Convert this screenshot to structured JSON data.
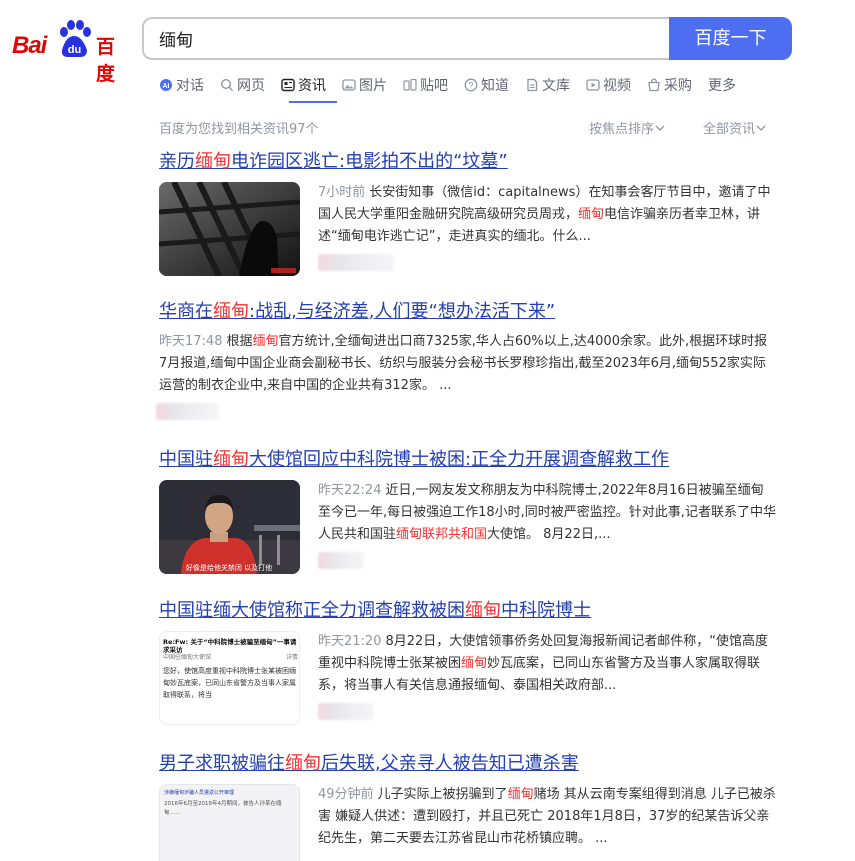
{
  "logo": {
    "bai": "Bai",
    "du": "du",
    "cn": "百度"
  },
  "search": {
    "query": "缅甸",
    "button_label": "百度一下"
  },
  "tabs": [
    {
      "label": "对话",
      "icon": "ai-chat-icon"
    },
    {
      "label": "网页",
      "icon": "search-icon"
    },
    {
      "label": "资讯",
      "icon": "news-icon"
    },
    {
      "label": "图片",
      "icon": "image-icon"
    },
    {
      "label": "贴吧",
      "icon": "tieba-icon"
    },
    {
      "label": "知道",
      "icon": "question-icon"
    },
    {
      "label": "文库",
      "icon": "document-icon"
    },
    {
      "label": "视频",
      "icon": "video-icon"
    },
    {
      "label": "采购",
      "icon": "shopping-icon"
    },
    {
      "label": "更多",
      "icon": ""
    }
  ],
  "info": {
    "count_text": "百度为您找到相关资讯97个",
    "sort_label": "按焦点排序",
    "filter_label": "全部资讯"
  },
  "results": [
    {
      "title_pre": "亲历",
      "title_hl": "缅甸",
      "title_post": "电诈园区逃亡:电影拍不出的“坟墓”",
      "time": "7小时前",
      "snippet_pre": "长安街知事（微信id：capitalnews）在知事会客厅节目中，邀请了中国人民大学重阳金融研究院高级研究员周戎，",
      "snippet_hl": "缅甸",
      "snippet_post": "电信诈骗亲历者幸卫林，讲述“缅甸电诈逃亡记”，走进真实的缅北。什么..."
    },
    {
      "title_pre": "华商在",
      "title_hl": "缅甸",
      "title_post": ":战乱,与经济差,人们要“想办法活下来”",
      "time": "昨天17:48",
      "snippet_pre": "根据",
      "snippet_hl": "缅甸",
      "snippet_post": "官方统计,全缅甸进出口商7325家,华人占60%以上,达4000余家。此外,根据环球时报7月报道,缅甸中国企业商会副秘书长、纺织与服装分会秘书长罗穆珍指出,截至2023年6月,缅甸552家实际运营的制衣企业中,来自中国的企业共有312家。 ..."
    },
    {
      "title_pre": "中国驻",
      "title_hl": "缅甸",
      "title_post": "大使馆回应中科院博士被困:正全力开展调查解救工作",
      "time": "昨天22:24",
      "snippet_pre": "近日,一网友发文称朋友为中科院博士,2022年8月16日被骗至缅甸至今已一年,每日被强迫工作18小时,同时被严密监控。针对此事,记者联系了中华人民共和国驻",
      "snippet_hl": "缅甸联邦共和国",
      "snippet_post": "大使馆。 8月22日,..."
    },
    {
      "title_pre": "中国驻缅大使馆称正全力调查解救被困",
      "title_hl": "缅甸",
      "title_post": "中科院博士",
      "time": "昨天21:20",
      "snippet_pre": "8月22日，大使馆领事侨务处回复海报新闻记者邮件称，“使馆高度重视中科院博士张某被困",
      "snippet_hl": "缅甸",
      "snippet_post": "妙瓦底案，已同山东省警方及当事人家属取得联系，将当事人有关信息通报缅甸、泰国相关政府部..."
    },
    {
      "title_pre": "男子求职被骗往",
      "title_hl": "缅甸",
      "title_post": "后失联,父亲寻人被告知已遭杀害",
      "time": "49分钟前",
      "snippet_pre": "儿子实际上被拐骗到了",
      "snippet_hl": "缅甸",
      "snippet_post": "赌场 其从云南专案组得到消息 儿子已被杀害 嫌疑人供述：遭到殴打，并且已死亡 2018年1月8日，37岁的纪某告诉父亲纪先生，第二天要去江苏省昆山市花桥镇应聘。 ..."
    }
  ],
  "thumbs": {
    "t2_caption": "好像是给他关禁闭 以及打他",
    "t3_head": "Re:Fw: 关于“中科院博士被骗至缅甸”一事请求采访",
    "t3_from": "中国驻缅甸大使馆",
    "t3_tag": "详情",
    "t3_body": "您好，使馆高度重视中科院博士张某被困缅甸妙瓦底案，已同山东省警方及当事人家属取得联系，将当",
    "t4_head": "涉嫌缅甸诈骗人员遣返公开审理",
    "t4_body": "2016年6月至2018年4月期间，被告人孙某在缅甸……"
  }
}
